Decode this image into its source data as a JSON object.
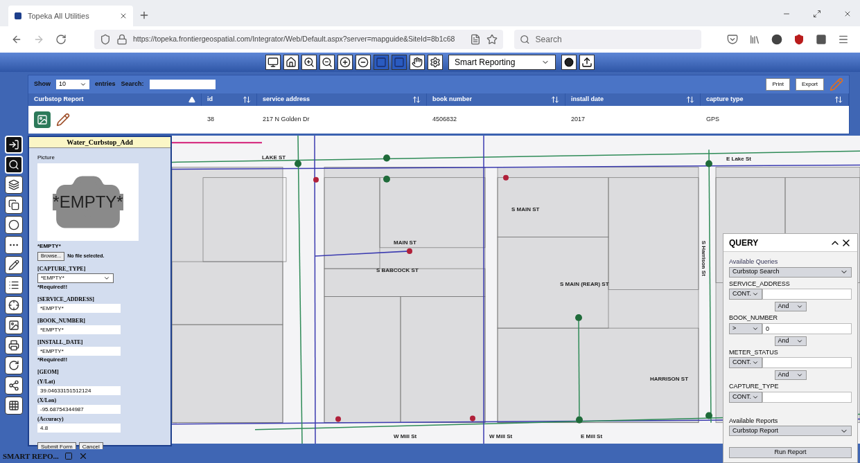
{
  "browser": {
    "tab_title": "Topeka All Utilities",
    "url": "https://topeka.frontiergeospatial.com/Integrator/Web/Default.aspx?server=mapguide&SiteId=8b1c68",
    "search_placeholder": "Search"
  },
  "toolbar": {
    "select_value": "Smart Reporting"
  },
  "table": {
    "show_label": "Show",
    "entries_value": "10",
    "entries_label": "entries",
    "search_label": "Search:",
    "buttons": [
      "Print",
      "Export"
    ],
    "columns": [
      {
        "label": "Curbstop Report",
        "sorted": true
      },
      {
        "label": "id",
        "sorted": false
      },
      {
        "label": "service address",
        "sorted": false
      },
      {
        "label": "book number",
        "sorted": false
      },
      {
        "label": "install date",
        "sorted": false
      },
      {
        "label": "capture type",
        "sorted": false
      }
    ],
    "rows": [
      {
        "cells": [
          "",
          "38",
          "217 N Golden Dr",
          "4506832",
          "2017",
          "GPS"
        ]
      }
    ]
  },
  "form": {
    "title": "Water_Curbstop_Add",
    "picture_label": "Picture",
    "picture_text": "*EMPTY*",
    "file_status": "*EMPTY*",
    "browse_button": "Browse...",
    "no_file": "No file selected.",
    "fields": [
      {
        "label": "[CAPTURE_TYPE]",
        "kind": "select",
        "value": "*EMPTY*",
        "note": "*Required!!"
      },
      {
        "label": "[SERVICE_ADDRESS]",
        "kind": "input",
        "value": "*EMPTY*"
      },
      {
        "label": "[BOOK_NUMBER]",
        "kind": "input",
        "value": "*EMPTY*"
      },
      {
        "label": "[INSTALL_DATE]",
        "kind": "input",
        "value": "*EMPTY*",
        "note": "*Required!!"
      }
    ],
    "geom_label": "[GEOM]",
    "geom_fields": [
      {
        "label": "(Y/Lat)",
        "value": "39.04633151512124"
      },
      {
        "label": "(X/Lon)",
        "value": "-95.68754344987"
      },
      {
        "label": "(Accuracy)",
        "value": "4.8"
      }
    ],
    "buttons": [
      "Submit Form",
      "Cancel"
    ]
  },
  "map": {
    "labels": [
      "LAKE ST",
      "MAIN ST",
      "S BABCOCK ST",
      "S MAIN ST",
      "E Lake St",
      "S MAIN (REAR) ST",
      "S Harrison St",
      "HARRISON ST",
      "W Mill St",
      "W Mill St",
      "E Mill St"
    ]
  },
  "query": {
    "title": "QUERY",
    "queries_label": "Available Queries",
    "query_value": "Curbstop Search",
    "conditions": [
      {
        "field": "SERVICE_ADDRESS",
        "operator": "CONT.",
        "conjunction": "And"
      },
      {
        "field": "BOOK_NUMBER",
        "operator": ">",
        "value": "0",
        "conjunction": "And"
      },
      {
        "field": "METER_STATUS",
        "operator": "CONT.",
        "conjunction": "And"
      },
      {
        "field": "CAPTURE_TYPE",
        "operator": "CONT."
      }
    ],
    "reports_label": "Available Reports",
    "report_value": "Curbstop Report",
    "run_button": "Run Report"
  },
  "bottom_tab": {
    "title": "SMART REPO..."
  }
}
